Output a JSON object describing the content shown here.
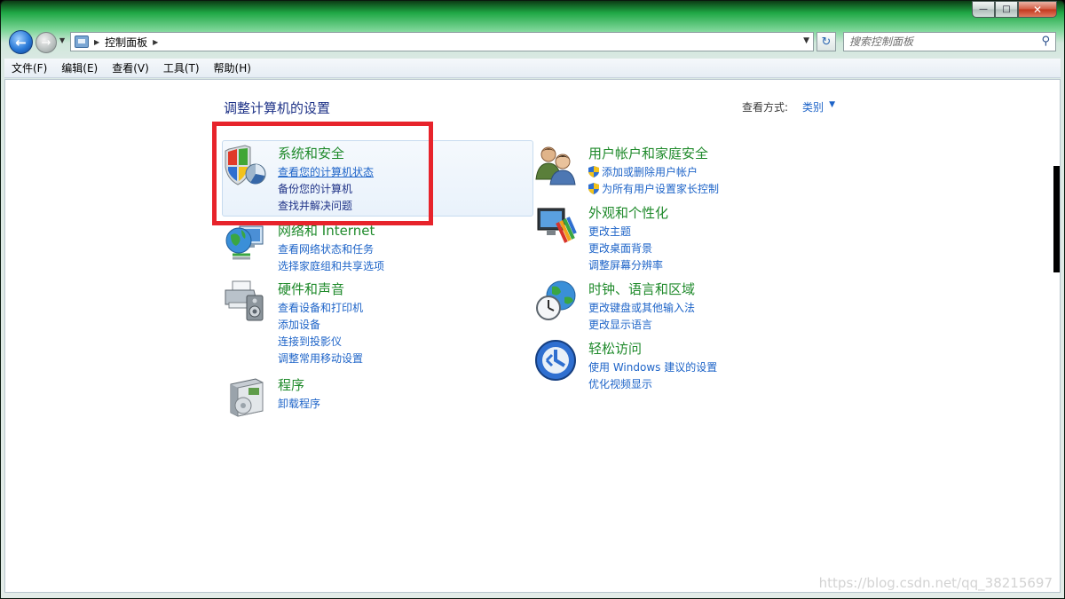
{
  "window": {
    "caption_buttons": {
      "minimize": "—",
      "maximize": "□",
      "close": "✕"
    }
  },
  "navbar": {
    "back_icon": "arrow-left-icon",
    "forward_icon": "arrow-right-icon",
    "breadcrumb": [
      "控制面板"
    ],
    "search_placeholder": "搜索控制面板"
  },
  "menu": [
    "文件(F)",
    "编辑(E)",
    "查看(V)",
    "工具(T)",
    "帮助(H)"
  ],
  "page": {
    "title": "调整计算机的设置",
    "view_by_label": "查看方式:",
    "view_by_value": "类别"
  },
  "categories": {
    "system_security": {
      "title": "系统和安全",
      "links": [
        "查看您的计算机状态",
        "备份您的计算机",
        "查找并解决问题"
      ]
    },
    "network": {
      "title": "网络和 Internet",
      "links": [
        "查看网络状态和任务",
        "选择家庭组和共享选项"
      ]
    },
    "hardware": {
      "title": "硬件和声音",
      "links": [
        "查看设备和打印机",
        "添加设备",
        "连接到投影仪",
        "调整常用移动设置"
      ]
    },
    "programs": {
      "title": "程序",
      "links": [
        "卸载程序"
      ]
    },
    "user_accounts": {
      "title": "用户帐户和家庭安全",
      "links": [
        "添加或删除用户帐户",
        "为所有用户设置家长控制"
      ]
    },
    "appearance": {
      "title": "外观和个性化",
      "links": [
        "更改主题",
        "更改桌面背景",
        "调整屏幕分辨率"
      ]
    },
    "clock_region": {
      "title": "时钟、语言和区域",
      "links": [
        "更改键盘或其他输入法",
        "更改显示语言"
      ]
    },
    "ease_access": {
      "title": "轻松访问",
      "links": [
        "使用 Windows 建议的设置",
        "优化视频显示"
      ]
    }
  },
  "watermark": "https://blog.csdn.net/qq_38215697"
}
